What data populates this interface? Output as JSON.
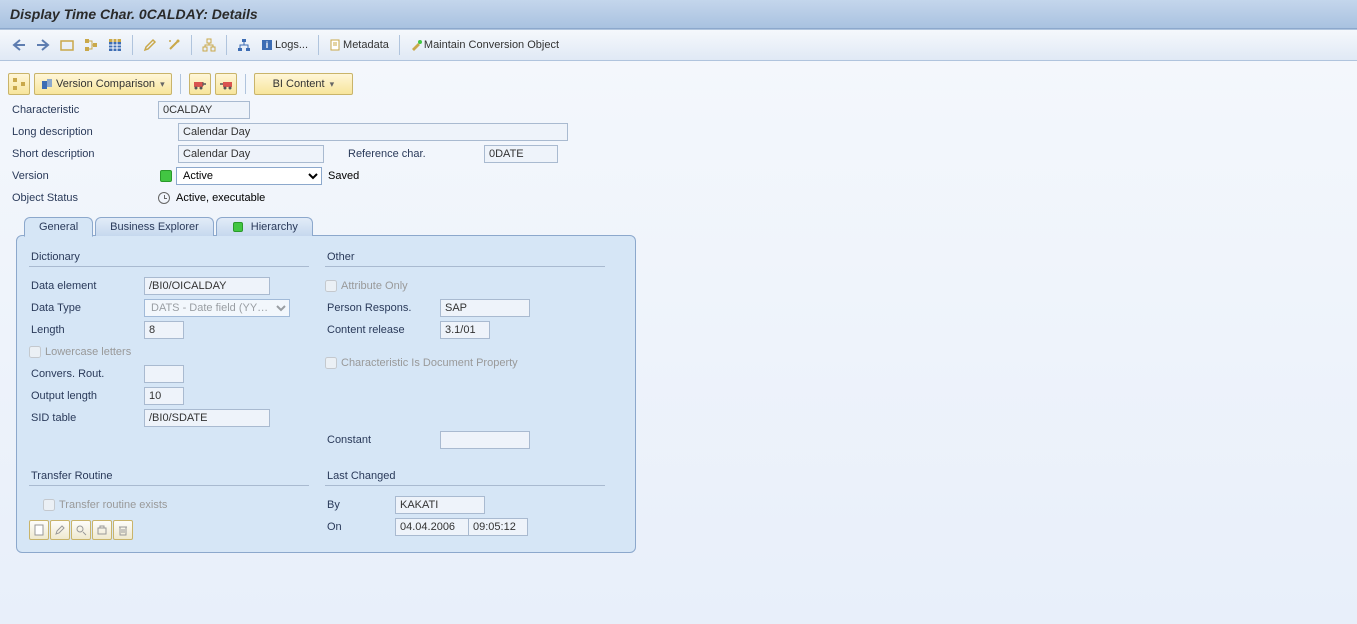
{
  "titlebar": {
    "title": "Display Time Char. 0CALDAY: Details"
  },
  "toolbar": {
    "logs_label": "Logs...",
    "metadata_label": "Metadata",
    "maintain_label": "Maintain Conversion Object"
  },
  "appbar": {
    "version_comparison": "Version Comparison",
    "bi_content": "BI Content"
  },
  "form": {
    "characteristic_label": "Characteristic",
    "characteristic_value": "0CALDAY",
    "long_desc_label": "Long description",
    "long_desc_value": "Calendar Day",
    "short_desc_label": "Short description",
    "short_desc_value": "Calendar Day",
    "ref_char_label": "Reference char.",
    "ref_char_value": "0DATE",
    "version_label": "Version",
    "version_value": "Active",
    "version_status": "Saved",
    "object_status_label": "Object Status",
    "object_status_value": "Active, executable"
  },
  "tabs": {
    "general": "General",
    "bex": "Business Explorer",
    "hierarchy": "Hierarchy"
  },
  "dictionary": {
    "title": "Dictionary",
    "data_element_label": "Data element",
    "data_element_value": "/BI0/OICALDAY",
    "data_type_label": "Data Type",
    "data_type_value": "DATS - Date field (YY…",
    "length_label": "Length",
    "length_value": "8",
    "lowercase_label": "Lowercase letters",
    "conv_rout_label": "Convers. Rout.",
    "conv_rout_value": "",
    "output_length_label": "Output length",
    "output_length_value": "10",
    "sid_table_label": "SID table",
    "sid_table_value": "/BI0/SDATE"
  },
  "other": {
    "title": "Other",
    "attr_only_label": "Attribute Only",
    "person_label": "Person Respons.",
    "person_value": "SAP",
    "content_rel_label": "Content release",
    "content_rel_value": "3.1/01",
    "doc_prop_label": "Characteristic Is Document Property",
    "constant_label": "Constant",
    "constant_value": ""
  },
  "transfer_routine": {
    "title": "Transfer Routine",
    "exists_label": "Transfer routine exists"
  },
  "last_changed": {
    "title": "Last Changed",
    "by_label": "By",
    "by_value": "KAKATI",
    "on_label": "On",
    "on_date": "04.04.2006",
    "on_time": "09:05:12"
  }
}
